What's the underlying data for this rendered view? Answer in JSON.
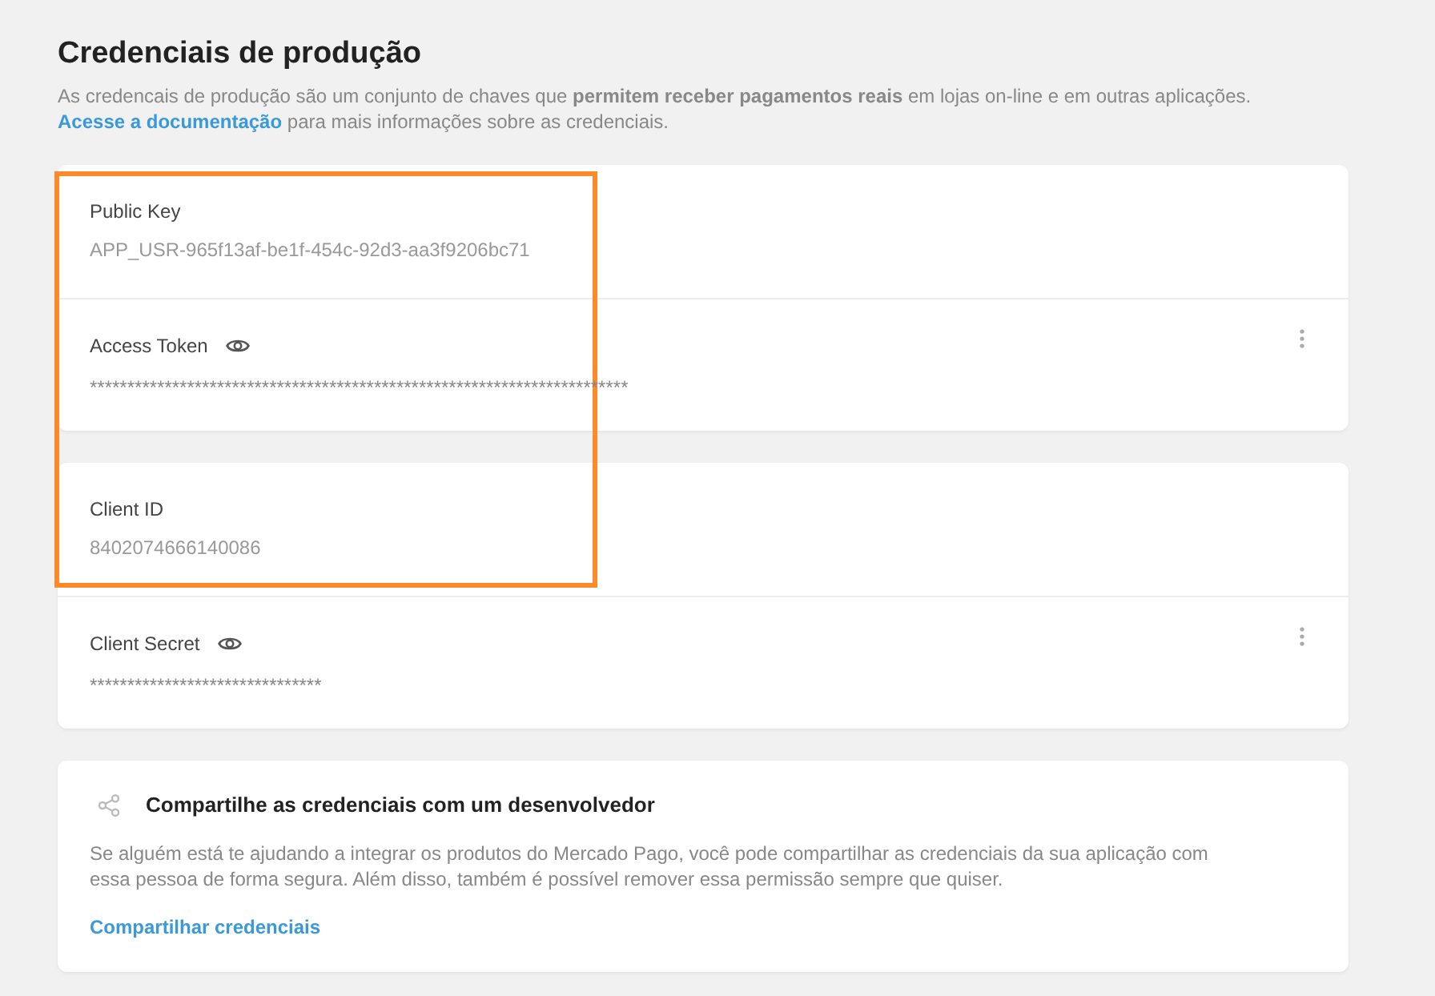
{
  "header": {
    "title": "Credenciais de produção",
    "description": {
      "text": "As credencais de produção são um conjunto de chaves que **permitem receber pagamentos reais** em lojas on-line e em outras aplicações.",
      "link": "Acesse a documentação",
      "after_link": "para mais informações sobre as credenciais."
    }
  },
  "credential_groups": [
    {
      "items": [
        {
          "kind": "plain",
          "label": "Public Key",
          "value": "APP_USR-965f13af-be1f-454c-92d3-aa3f9206bc71"
        },
        {
          "kind": "secret",
          "label": "Access Token",
          "value": "************************************************************************"
        }
      ]
    },
    {
      "items": [
        {
          "kind": "plain",
          "label": "Client ID",
          "value": "8402074666140086"
        },
        {
          "kind": "secret",
          "label": "Client Secret",
          "value": "*******************************"
        }
      ]
    }
  ],
  "share": {
    "title": "Compartilhe as credenciais com um desenvolvedor",
    "text": "Se alguém está te ajudando a integrar os produtos do Mercado Pago, você pode compartilhar as credenciais da sua aplicação com essa pessoa de forma segura. Além disso, também é possível remover essa permissão sempre que quiser.",
    "link": "Compartilhar credenciais"
  }
}
